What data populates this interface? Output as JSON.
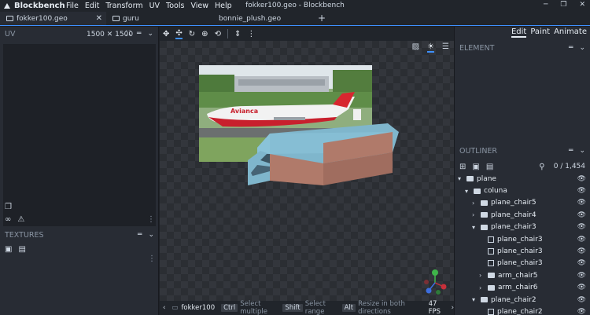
{
  "app": {
    "name": "Blockbench",
    "window_title": "fokker100.geo - Blockbench",
    "menu": [
      "File",
      "Edit",
      "Transform",
      "UV",
      "Tools",
      "View",
      "Help"
    ],
    "window_controls": [
      "─",
      "❐",
      "✕"
    ]
  },
  "tabs": [
    {
      "label": "fokker100.geo",
      "active": true
    },
    {
      "label": "guru",
      "active": false
    },
    {
      "label": "bonnie_plush.geo",
      "active": false
    }
  ],
  "new_tab_label": "+",
  "left_panel": {
    "uv_title": "UV",
    "uv_size": "1500 ✕ 1500",
    "textures_title": "TEXTURES"
  },
  "modes": [
    "Edit",
    "Paint",
    "Animate"
  ],
  "right_panel": {
    "element_title": "ELEMENT",
    "outliner_title": "OUTLINER",
    "outliner_count": "0 / 1,454"
  },
  "outliner": [
    {
      "label": "plane",
      "type": "folder",
      "depth": 0,
      "arrow": "▾"
    },
    {
      "label": "coluna",
      "type": "folder",
      "depth": 1,
      "arrow": "▾"
    },
    {
      "label": "plane_chair5",
      "type": "folder",
      "depth": 2,
      "arrow": "›"
    },
    {
      "label": "plane_chair4",
      "type": "folder",
      "depth": 2,
      "arrow": "›"
    },
    {
      "label": "plane_chair3",
      "type": "folder",
      "depth": 2,
      "arrow": "▾"
    },
    {
      "label": "plane_chair3",
      "type": "cube",
      "depth": 3,
      "arrow": ""
    },
    {
      "label": "plane_chair3",
      "type": "cube",
      "depth": 3,
      "arrow": ""
    },
    {
      "label": "plane_chair3",
      "type": "cube",
      "depth": 3,
      "arrow": ""
    },
    {
      "label": "arm_chair5",
      "type": "folder",
      "depth": 3,
      "arrow": "›"
    },
    {
      "label": "arm_chair6",
      "type": "folder",
      "depth": 3,
      "arrow": "›"
    },
    {
      "label": "plane_chair2",
      "type": "folder",
      "depth": 2,
      "arrow": "▾"
    },
    {
      "label": "plane_chair2",
      "type": "cube",
      "depth": 3,
      "arrow": ""
    }
  ],
  "status": {
    "model_name": "fokker100",
    "hints": [
      {
        "key": "Ctrl",
        "text": "Select multiple"
      },
      {
        "key": "Shift",
        "text": "Select range"
      },
      {
        "key": "Alt",
        "text": "Resize in both directions"
      }
    ],
    "fps": "47 FPS"
  },
  "reference_image": {
    "airline_text": "Avianca"
  },
  "colors": {
    "accent": "#3e90ff",
    "model_cabin": "#7fb6cc",
    "model_side": "#b07a6a"
  }
}
